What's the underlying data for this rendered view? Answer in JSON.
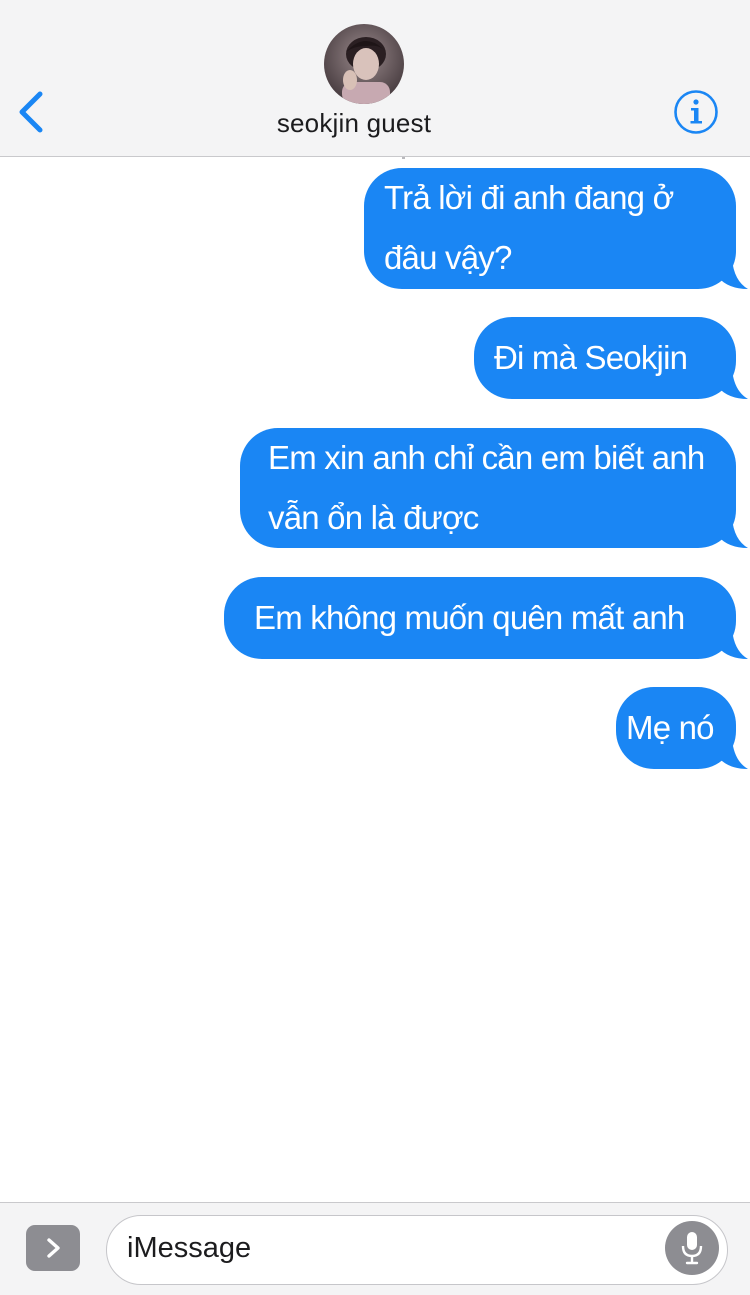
{
  "header": {
    "contact_name": "seokjin guest",
    "back_icon": "chevron-left-icon",
    "info_icon": "info-icon",
    "accent_color": "#1a86f4"
  },
  "messages": [
    {
      "sender": "me",
      "lines": [
        "Trả lời đi anh đang ở",
        "đâu vậy?"
      ]
    },
    {
      "sender": "me",
      "lines": [
        "Đi mà Seokjin"
      ]
    },
    {
      "sender": "me",
      "lines": [
        "Em xin anh chỉ cần em biết anh",
        "vẫn ổn là được"
      ]
    },
    {
      "sender": "me",
      "lines": [
        "Em không muốn quên mất anh"
      ]
    },
    {
      "sender": "me",
      "lines": [
        "Mẹ nó"
      ]
    }
  ],
  "input_bar": {
    "placeholder": "iMessage",
    "apps_icon": "chevron-right-icon",
    "mic_icon": "microphone-icon"
  },
  "colors": {
    "bubble_sent": "#1a86f4",
    "header_bg": "#f4f4f5",
    "text_on_bubble": "#ffffff"
  }
}
